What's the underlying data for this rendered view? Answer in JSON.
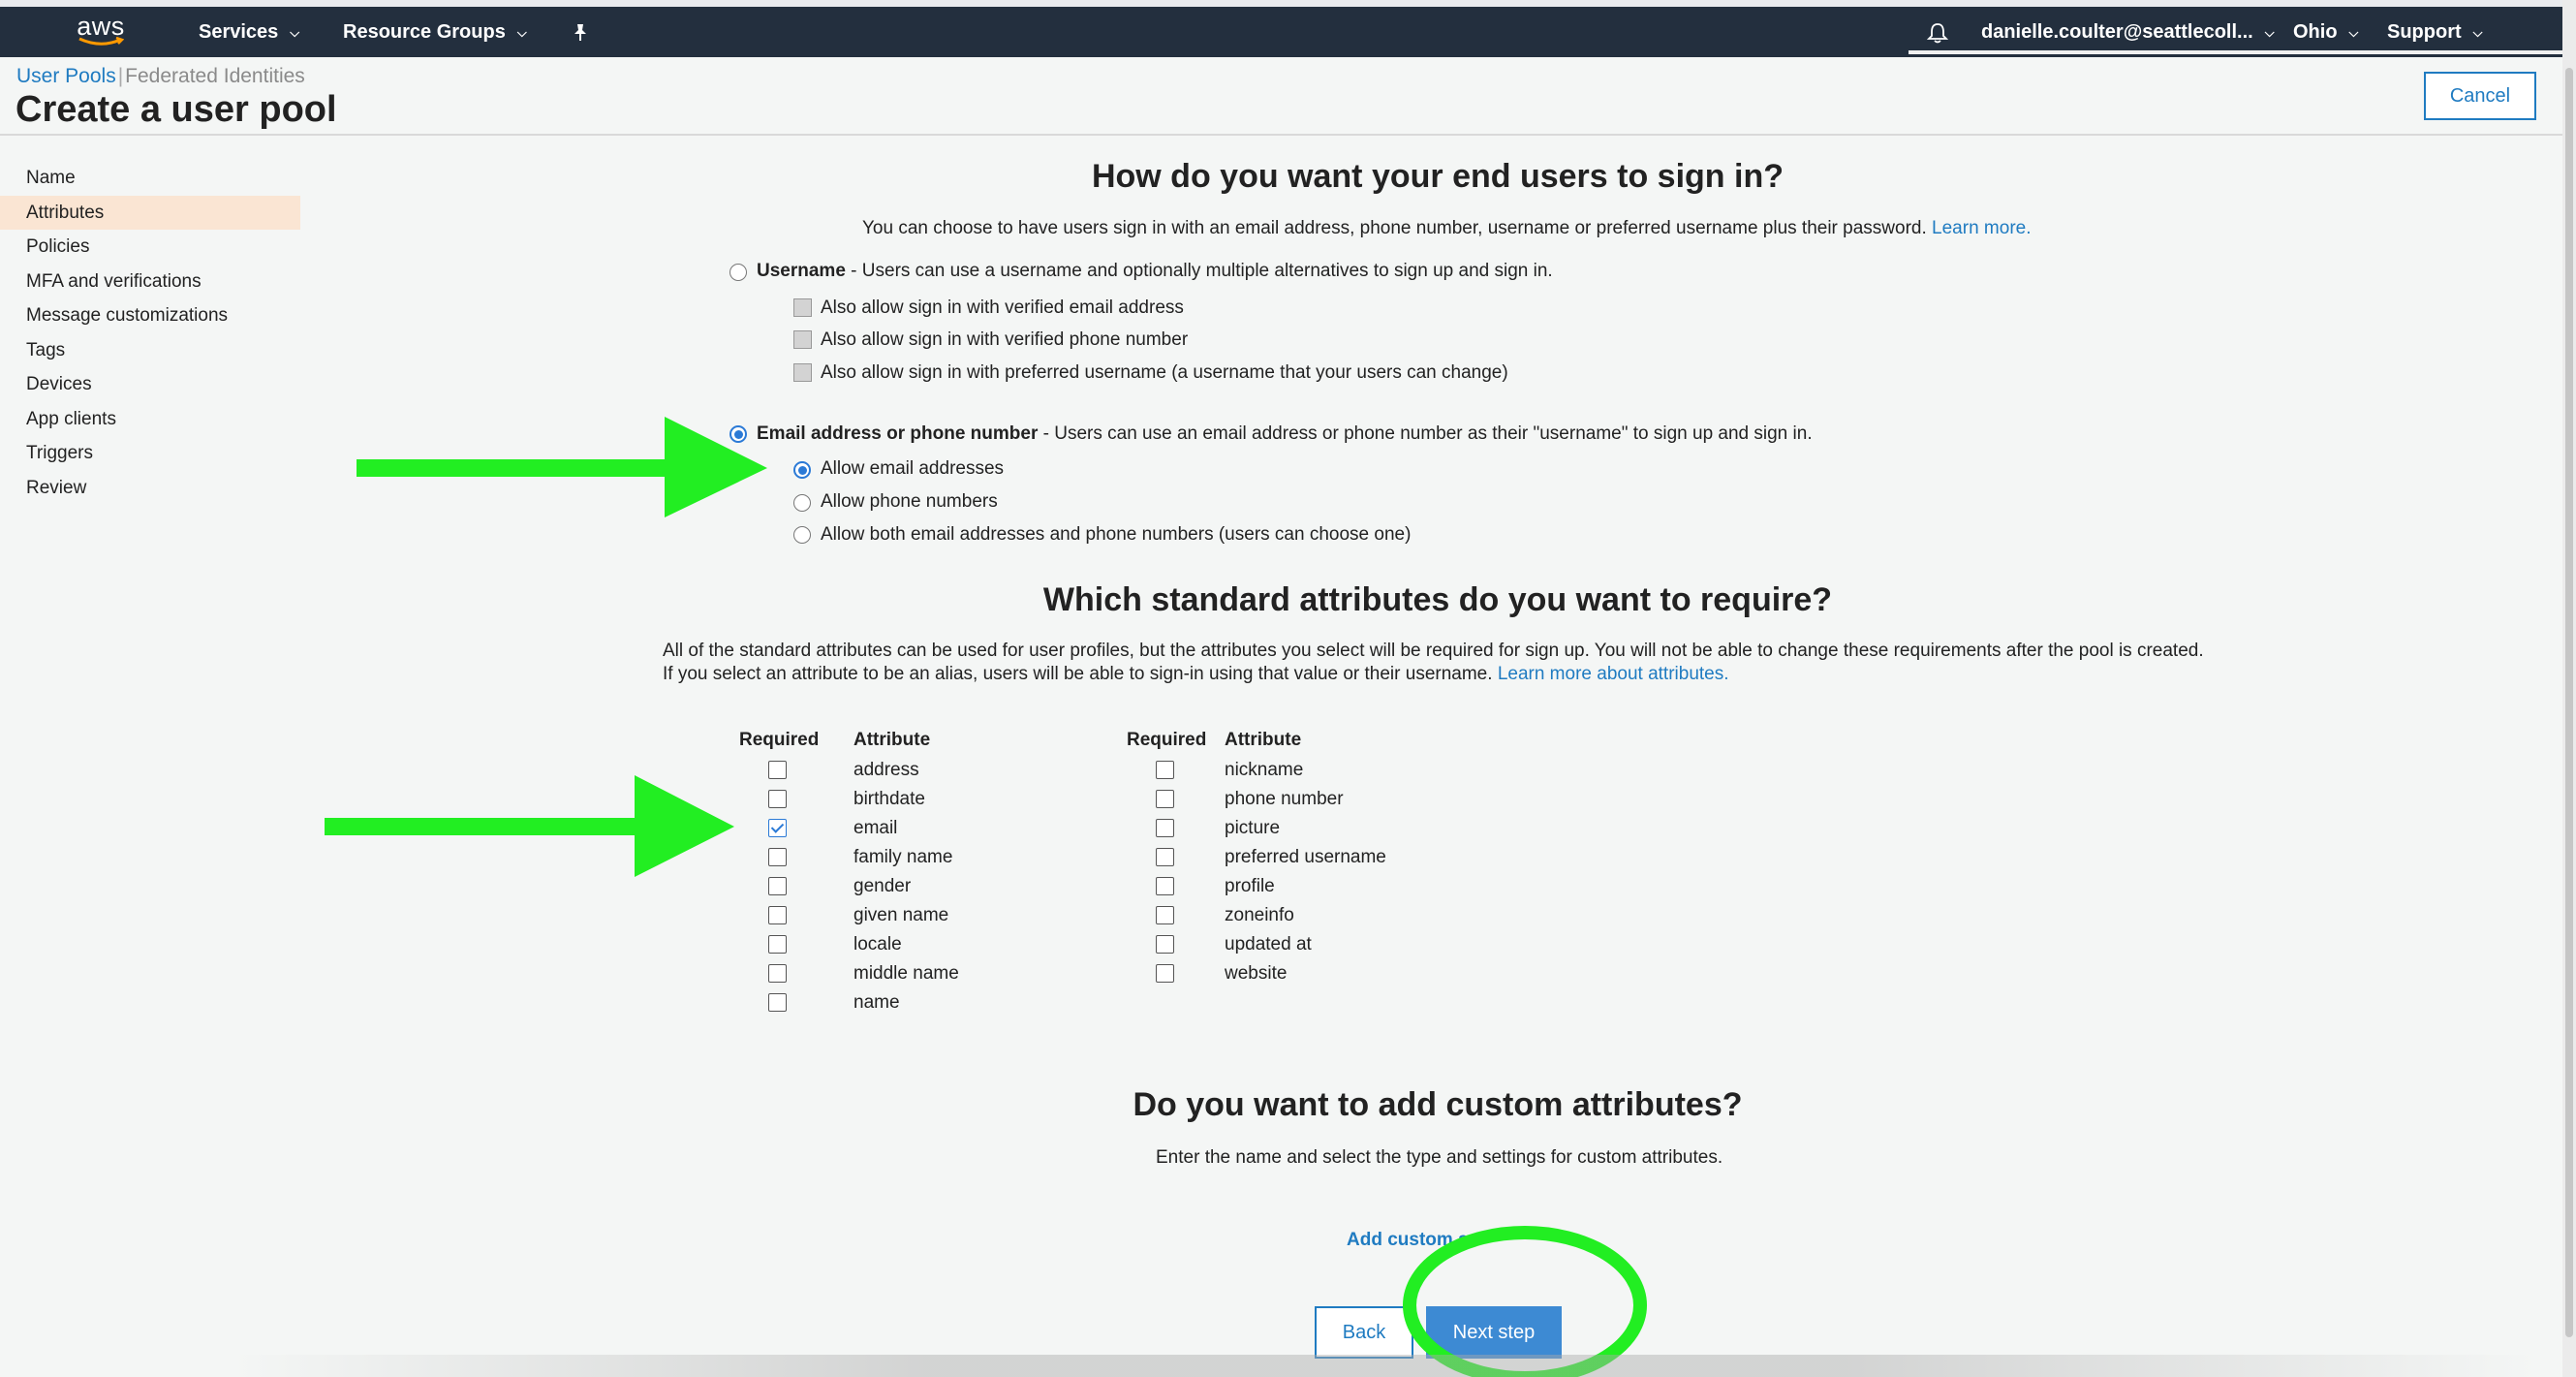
{
  "nav": {
    "logo_text": "aws",
    "services": "Services",
    "resource_groups": "Resource Groups",
    "user": "danielle.coulter@seattlecoll...",
    "region": "Ohio",
    "support": "Support",
    "icons": [
      "pin-icon",
      "bell-icon",
      "chevron-down-icon"
    ]
  },
  "breadcrumb": {
    "user_pools": "User Pools",
    "separator": "|",
    "federated": "Federated Identities"
  },
  "page_title": "Create a user pool",
  "cancel_label": "Cancel",
  "sidebar": {
    "items": [
      {
        "label": "Name",
        "active": false
      },
      {
        "label": "Attributes",
        "active": true
      },
      {
        "label": "Policies",
        "active": false
      },
      {
        "label": "MFA and verifications",
        "active": false
      },
      {
        "label": "Message customizations",
        "active": false
      },
      {
        "label": "Tags",
        "active": false
      },
      {
        "label": "Devices",
        "active": false
      },
      {
        "label": "App clients",
        "active": false
      },
      {
        "label": "Triggers",
        "active": false
      },
      {
        "label": "Review",
        "active": false
      }
    ]
  },
  "signin": {
    "heading": "How do you want your end users to sign in?",
    "desc": "You can choose to have users sign in with an email address, phone number, username or preferred username plus their password.",
    "learn_more": "Learn more.",
    "username_option": {
      "title": "Username",
      "rest": " - Users can use a username and optionally multiple alternatives to sign up and sign in.",
      "selected": false
    },
    "username_suboptions": [
      "Also allow sign in with verified email address",
      "Also allow sign in with verified phone number",
      "Also allow sign in with preferred username (a username that your users can change)"
    ],
    "email_option": {
      "title": "Email address or phone number",
      "rest": " - Users can use an email address or phone number as their \"username\" to sign up and sign in.",
      "selected": true
    },
    "email_suboptions": [
      {
        "label": "Allow email addresses",
        "selected": true
      },
      {
        "label": "Allow phone numbers",
        "selected": false
      },
      {
        "label": "Allow both email addresses and phone numbers (users can choose one)",
        "selected": false
      }
    ]
  },
  "standard": {
    "heading": "Which standard attributes do you want to require?",
    "desc": "All of the standard attributes can be used for user profiles, but the attributes you select will be required for sign up. You will not be able to change these requirements after the pool is created. If you select an attribute to be an alias, users will be able to sign-in using that value or their username.",
    "learn_more": "Learn more about attributes.",
    "col_required": "Required",
    "col_attribute": "Attribute",
    "left": [
      {
        "name": "address",
        "required": false
      },
      {
        "name": "birthdate",
        "required": false
      },
      {
        "name": "email",
        "required": true
      },
      {
        "name": "family name",
        "required": false
      },
      {
        "name": "gender",
        "required": false
      },
      {
        "name": "given name",
        "required": false
      },
      {
        "name": "locale",
        "required": false
      },
      {
        "name": "middle name",
        "required": false
      },
      {
        "name": "name",
        "required": false
      }
    ],
    "right": [
      {
        "name": "nickname",
        "required": false
      },
      {
        "name": "phone number",
        "required": false
      },
      {
        "name": "picture",
        "required": false
      },
      {
        "name": "preferred username",
        "required": false
      },
      {
        "name": "profile",
        "required": false
      },
      {
        "name": "zoneinfo",
        "required": false
      },
      {
        "name": "updated at",
        "required": false
      },
      {
        "name": "website",
        "required": false
      }
    ]
  },
  "custom": {
    "heading": "Do you want to add custom attributes?",
    "desc": "Enter the name and select the type and settings for custom attributes.",
    "add_link": "Add custom a"
  },
  "footer": {
    "back": "Back",
    "next": "Next step"
  },
  "colors": {
    "nav_bg": "#232f3e",
    "link": "#1f7bc1",
    "primary_button": "#3d8ad3",
    "active_sidebar": "#fae5d3",
    "annotation_green": "#22ee22"
  }
}
